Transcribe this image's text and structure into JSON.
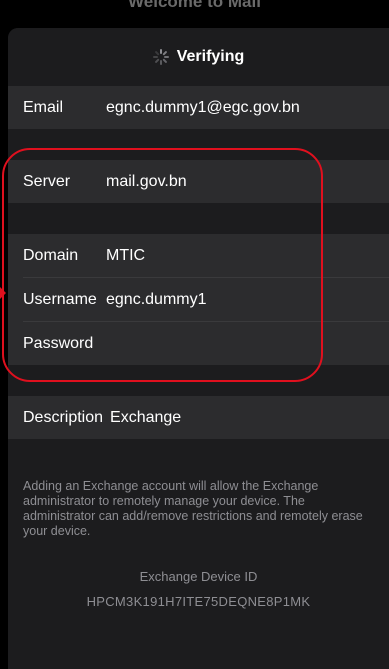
{
  "background_title": "Welcome to Mail",
  "nav": {
    "title": "Verifying",
    "spinner_icon": "activity-spinner-icon"
  },
  "form": {
    "email": {
      "label": "Email",
      "value": "egnc.dummy1@egc.gov.bn"
    },
    "server": {
      "label": "Server",
      "value": "mail.gov.bn"
    },
    "domain": {
      "label": "Domain",
      "value": "MTIC"
    },
    "username": {
      "label": "Username",
      "value": "egnc.dummy1"
    },
    "password": {
      "label": "Password",
      "value": ""
    },
    "description": {
      "label": "Description",
      "value": "Exchange"
    }
  },
  "footer": {
    "info": "Adding an Exchange account will allow the Exchange administrator to remotely manage your device. The administrator can add/remove restrictions and remotely erase your device.",
    "device_id_label": "Exchange Device ID",
    "device_id": "HPCM3K191H7ITE75DEQNE8P1MK"
  },
  "colors": {
    "highlight": "#e0101e",
    "sheet": "#1c1c1e",
    "row": "#2c2c2e",
    "secondary_text": "#8e8e93"
  }
}
